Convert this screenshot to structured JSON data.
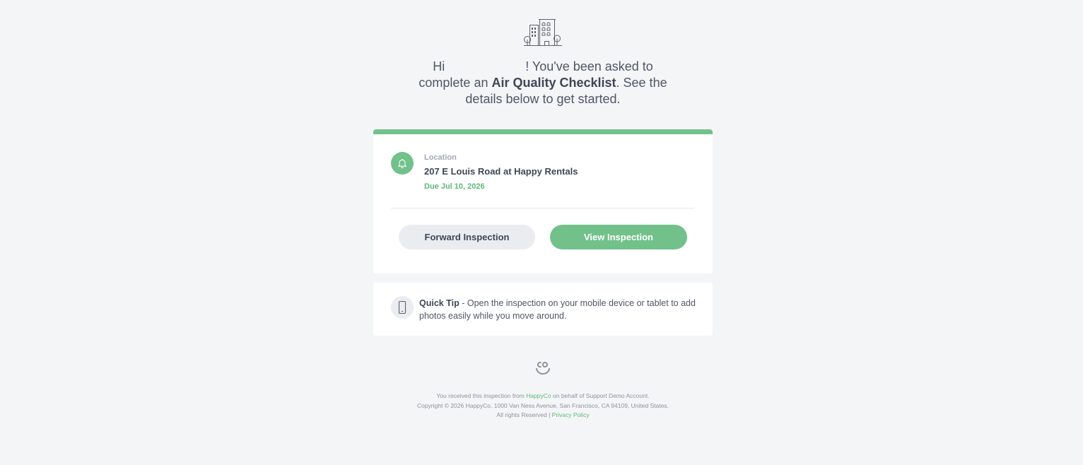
{
  "greeting": {
    "hi": "Hi",
    "after_name": "! You've been asked to",
    "line2_prefix": "complete an ",
    "checklist_name": "Air Quality Checklist",
    "line2_suffix": ". See the",
    "line3": "details below to get started."
  },
  "card": {
    "accent_color": "#72c18b",
    "location_label": "Location",
    "location_value": "207 E Louis Road at Happy Rentals",
    "due": "Due Jul 10, 2026",
    "forward_button": "Forward Inspection",
    "view_button": "View Inspection"
  },
  "tip": {
    "title": "Quick Tip",
    "text": " - Open the inspection on your mobile device or tablet to add photos easily while you move around."
  },
  "footer": {
    "line1_prefix": "You received this inspection from ",
    "line1_link": "HappyCo",
    "line1_suffix": " on behalf of Support Demo Account.",
    "line2": "Copyright © 2026 HappyCo. 1000 Van Ness Avenue, San Francisco, CA 94109, United States.",
    "line3_prefix": "All rights Reserved | ",
    "privacy_link": "Privacy Policy"
  },
  "icons": {
    "header": "building-icon",
    "location": "bell-icon",
    "tip": "phone-icon",
    "logo": "happyco-logo-icon"
  }
}
